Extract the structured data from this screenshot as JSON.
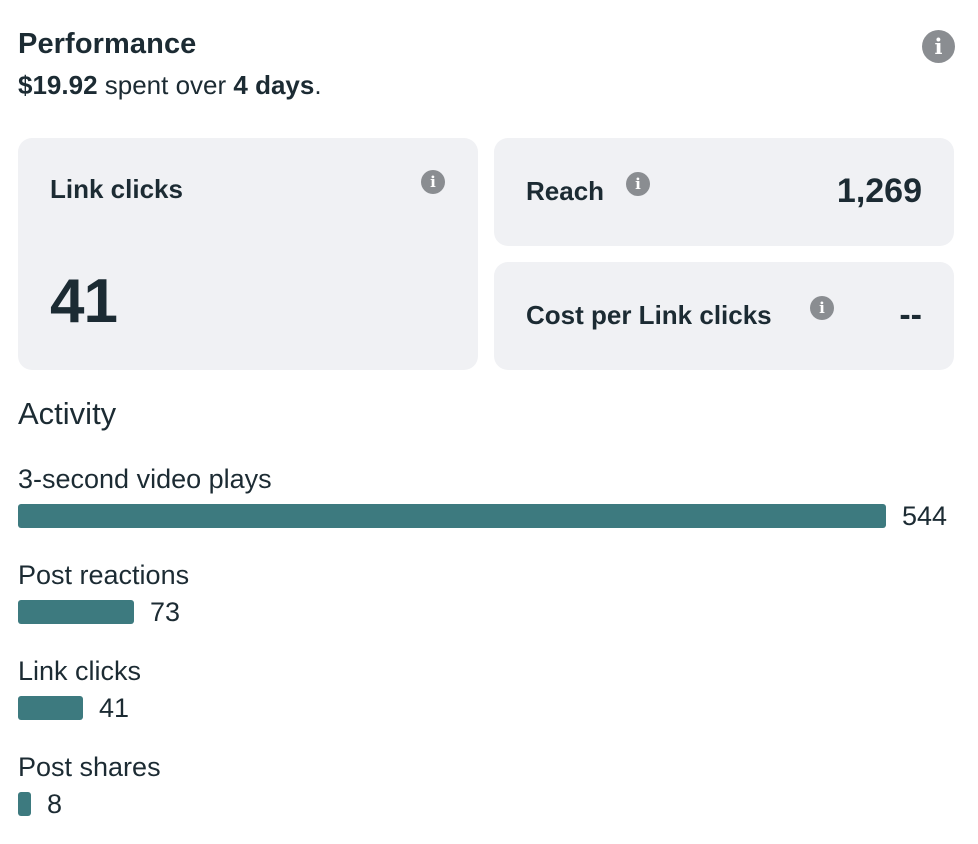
{
  "header": {
    "title": "Performance",
    "spent_amount": "$19.92",
    "spent_text": "spent over",
    "duration": "4 days",
    "period_end": ".",
    "info_icon": "info-icon"
  },
  "cards": {
    "link_clicks": {
      "label": "Link clicks",
      "value": "41"
    },
    "reach": {
      "label": "Reach",
      "value": "1,269"
    },
    "cost_per_link_click": {
      "label": "Cost per Link clicks",
      "value": "--"
    }
  },
  "activity": {
    "title": "Activity",
    "max_value": 544,
    "bar_color": "#3d7a7f",
    "items": [
      {
        "label": "3-second video plays",
        "value": "544",
        "amount": 544
      },
      {
        "label": "Post reactions",
        "value": "73",
        "amount": 73
      },
      {
        "label": "Link clicks",
        "value": "41",
        "amount": 41
      },
      {
        "label": "Post shares",
        "value": "8",
        "amount": 8
      }
    ]
  }
}
